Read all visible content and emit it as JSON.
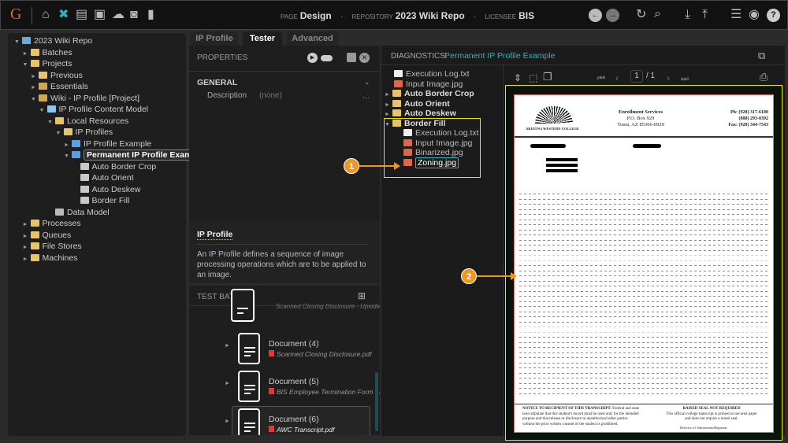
{
  "topbar": {
    "logo": "G",
    "page_label": "PAGE",
    "page": "Design",
    "repo_label": "REPOSITORY",
    "repo": "2023 Wiki Repo",
    "licensee_label": "LICENSEE",
    "licensee": "BIS"
  },
  "tree": [
    {
      "label": "2023 Wiki Repo",
      "indent": 0,
      "arrow": "▼",
      "icon": "repo"
    },
    {
      "label": "Batches",
      "indent": 1,
      "arrow": "►",
      "icon": "folder"
    },
    {
      "label": "Projects",
      "indent": 1,
      "arrow": "▼",
      "icon": "folder"
    },
    {
      "label": "Previous",
      "indent": 2,
      "arrow": "►",
      "icon": "folder"
    },
    {
      "label": "Essentials",
      "indent": 2,
      "arrow": "►",
      "icon": "project"
    },
    {
      "label": "Wiki - IP Profile [Project]",
      "indent": 2,
      "arrow": "▼",
      "icon": "project"
    },
    {
      "label": "IP Profile Content Model",
      "indent": 3,
      "arrow": "▼",
      "icon": "model"
    },
    {
      "label": "Local Resources",
      "indent": 4,
      "arrow": "▼",
      "icon": "folder"
    },
    {
      "label": "IP Profiles",
      "indent": 5,
      "arrow": "▼",
      "icon": "folder"
    },
    {
      "label": "IP Profile Example",
      "indent": 6,
      "arrow": "►",
      "icon": "profile"
    },
    {
      "label": "Permanent IP Profile Example",
      "indent": 6,
      "arrow": "▼",
      "icon": "profile",
      "selected": true
    },
    {
      "label": "Auto Border Crop",
      "indent": 7,
      "arrow": "",
      "icon": "op"
    },
    {
      "label": "Auto Orient",
      "indent": 7,
      "arrow": "",
      "icon": "op"
    },
    {
      "label": "Auto Deskew",
      "indent": 7,
      "arrow": "",
      "icon": "op"
    },
    {
      "label": "Border Fill",
      "indent": 7,
      "arrow": "",
      "icon": "op"
    },
    {
      "label": "Data Model",
      "indent": 4,
      "arrow": "",
      "icon": "data"
    },
    {
      "label": "Processes",
      "indent": 1,
      "arrow": "►",
      "icon": "folder"
    },
    {
      "label": "Queues",
      "indent": 1,
      "arrow": "►",
      "icon": "folder"
    },
    {
      "label": "File Stores",
      "indent": 1,
      "arrow": "►",
      "icon": "folder"
    },
    {
      "label": "Machines",
      "indent": 1,
      "arrow": "►",
      "icon": "folder"
    }
  ],
  "tabs": [
    "IP Profile",
    "Tester",
    "Advanced"
  ],
  "properties": {
    "title": "PROPERTIES",
    "section": "GENERAL",
    "desc_label": "Description",
    "desc_value": "(none)",
    "more": "..."
  },
  "help": {
    "title": "IP Profile",
    "text": "An IP Profile defines a sequence of image processing operations which are to be applied to an image."
  },
  "test_batch": {
    "title": "TEST BATCH",
    "partial_file": "Scanned Closing Disclosure - Upside",
    "docs": [
      {
        "name": "Document (4)",
        "file": "Scanned Closing Disclosure.pdf"
      },
      {
        "name": "Document (5)",
        "file": "BIS Employee Termination Form - M"
      },
      {
        "name": "Document (6)",
        "file": "AWC Transcript.pdf"
      }
    ]
  },
  "diagnostics": {
    "label": "DIAGNOSTICS:",
    "profile": "Permanent IP Profile Example",
    "files": [
      {
        "label": "Execution Log.txt",
        "indent": 1,
        "type": "txt"
      },
      {
        "label": "Input Image.jpg",
        "indent": 1,
        "type": "img"
      },
      {
        "label": "Auto Border Crop",
        "indent": 0,
        "type": "folder"
      },
      {
        "label": "Auto Orient",
        "indent": 0,
        "type": "folder"
      },
      {
        "label": "Auto Deskew",
        "indent": 0,
        "type": "folder"
      },
      {
        "label": "Border Fill",
        "indent": 0,
        "type": "folder",
        "open": true
      },
      {
        "label": "Execution Log.txt",
        "indent": 2,
        "type": "txt"
      },
      {
        "label": "Input Image.jpg",
        "indent": 2,
        "type": "img"
      },
      {
        "label": "Binarized.jpg",
        "indent": 2,
        "type": "img"
      },
      {
        "label": "Zoning.jpg",
        "indent": 2,
        "type": "img",
        "selected": true
      }
    ]
  },
  "viewer": {
    "page": "1",
    "total": "/ 1"
  },
  "document": {
    "office": "Enrollment Services",
    "addr1": "P.O. Box 929",
    "addr2": "Yuma, AZ 85366-0929",
    "ph": "Ph: (928) 317-6100",
    "ph2": "(888) 293-0392",
    "fax": "Fax: (928) 344-7543",
    "college": "ARIZONA WESTERN COLLEGE",
    "notice_title": "NOTICE TO RECIPIENT OF THIS TRANSCRIPT:",
    "notice": "Federal and state laws stipulate that this student's record must be used only for the intended purpose and that release or disclosure to unauthorized other parties without the prior written consent of the student is prohibited.",
    "seal_title": "RAISED SEAL NOT REQUIRED",
    "seal": "This official college transcript is printed on secured paper and does not require a raised seal.",
    "sign": "Director of Admissions/Registrar"
  },
  "callouts": [
    "1",
    "2"
  ],
  "colors": {
    "accent": "#2bb5c4",
    "highlight": "#e6e600",
    "callout": "#f0961e"
  }
}
